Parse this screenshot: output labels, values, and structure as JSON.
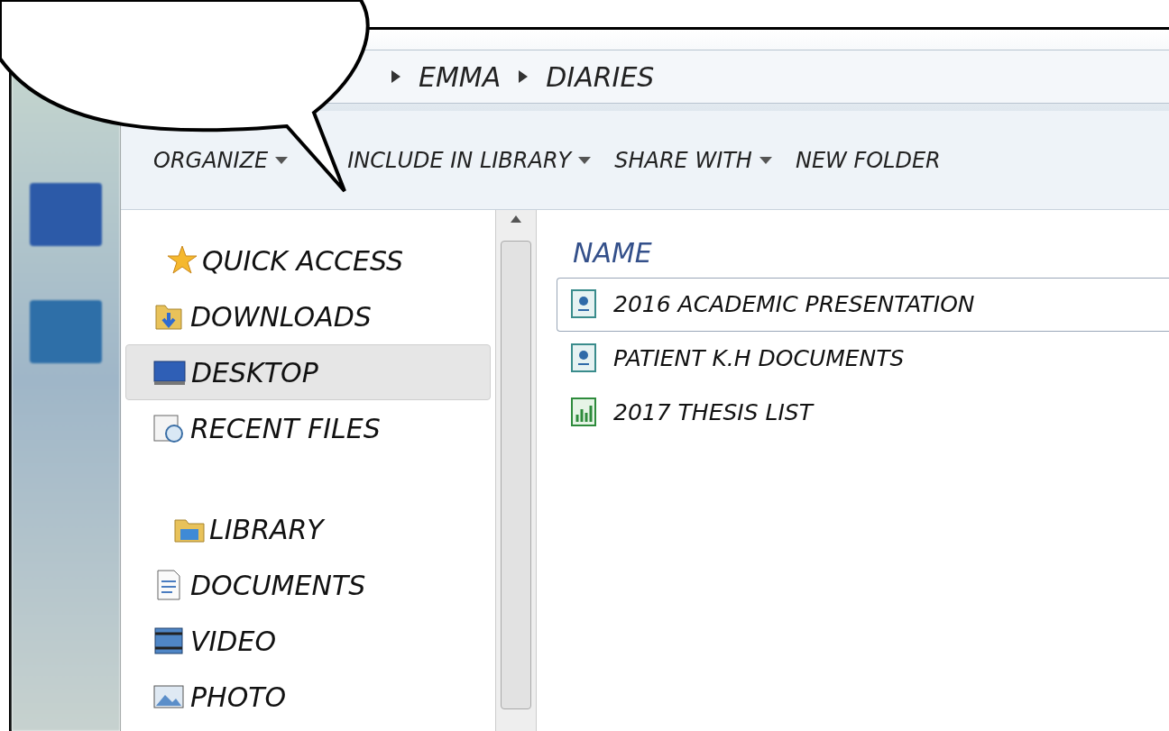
{
  "breadcrumb": [
    {
      "label": "EMMA"
    },
    {
      "label": "DIARIES"
    }
  ],
  "toolbar": [
    {
      "label": "ORGANIZE",
      "dropdown": true
    },
    {
      "label": "INCLUDE IN LIBRARY",
      "dropdown": true
    },
    {
      "label": "SHARE WITH",
      "dropdown": true
    },
    {
      "label": "NEW FOLDER",
      "dropdown": false
    }
  ],
  "sidebar": {
    "groups": [
      {
        "label": "QUICK ACCESS",
        "kind": "star",
        "children": [
          {
            "label": "DOWNLOADS",
            "kind": "downloads",
            "selected": false
          },
          {
            "label": "DESKTOP",
            "kind": "desktop",
            "selected": true
          },
          {
            "label": "RECENT FILES",
            "kind": "recent",
            "selected": false
          }
        ]
      },
      {
        "label": "LIBRARY",
        "kind": "library",
        "children": [
          {
            "label": "DOCUMENTS",
            "kind": "documents",
            "selected": false
          },
          {
            "label": "VIDEO",
            "kind": "video",
            "selected": false
          },
          {
            "label": "PHOTO",
            "kind": "photo",
            "selected": false
          }
        ]
      }
    ]
  },
  "files": {
    "column": "NAME",
    "rows": [
      {
        "name": "2016 ACADEMIC PRESENTATION",
        "kind": "presentation",
        "selected": true
      },
      {
        "name": "PATIENT K.H DOCUMENTS",
        "kind": "presentation",
        "selected": false
      },
      {
        "name": "2017 THESIS LIST",
        "kind": "spreadsheet",
        "selected": false
      }
    ]
  }
}
